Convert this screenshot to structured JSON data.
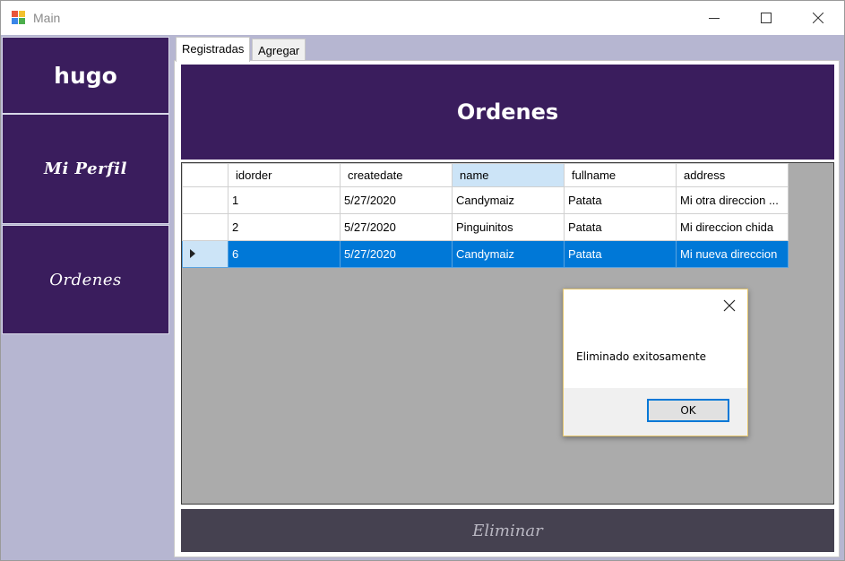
{
  "window": {
    "title": "Main"
  },
  "sidebar": {
    "user": "hugo",
    "items": [
      {
        "label": "Mi Perfil"
      },
      {
        "label": "Ordenes"
      }
    ]
  },
  "tabs": [
    {
      "label": "Registradas",
      "active": true
    },
    {
      "label": "Agregar",
      "active": false
    }
  ],
  "banner": {
    "title": "Ordenes"
  },
  "grid": {
    "columns": [
      "idorder",
      "createdate",
      "name",
      "fullname",
      "address"
    ],
    "sorted_column": "name",
    "rows": [
      {
        "cells": [
          "1",
          "5/27/2020",
          "Candymaiz",
          "Patata",
          "Mi otra direccion ..."
        ],
        "selected": false
      },
      {
        "cells": [
          "2",
          "5/27/2020",
          "Pinguinitos",
          "Patata",
          "Mi direccion chida"
        ],
        "selected": false
      },
      {
        "cells": [
          "6",
          "5/27/2020",
          "Candymaiz",
          "Patata",
          "Mi nueva direccion"
        ],
        "selected": true
      }
    ]
  },
  "dialog": {
    "message": "Eliminado exitosamente",
    "ok_label": "OK"
  },
  "actions": {
    "delete_label": "Eliminar"
  },
  "colors": {
    "sidebar": "#3a1d5d",
    "client_bg": "#b6b6d1",
    "selection": "#0078d7",
    "grid_bg": "#ababab",
    "delete_btn": "#454150"
  },
  "icons": {
    "app": "app-icon",
    "minimize": "minimize-icon",
    "maximize": "maximize-icon",
    "close": "close-icon",
    "row_pointer": "row-pointer-icon",
    "dialog_close": "close-icon"
  }
}
